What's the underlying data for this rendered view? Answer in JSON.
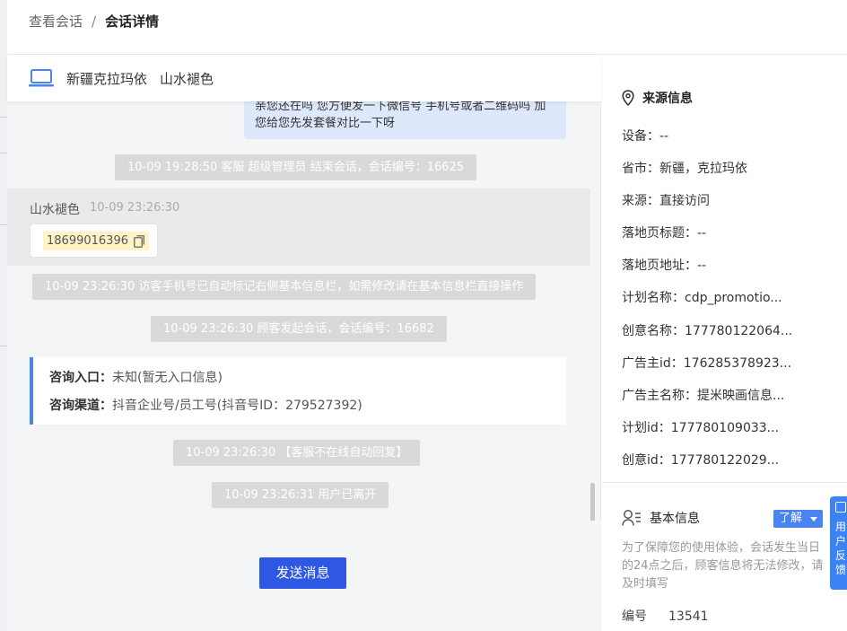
{
  "breadcrumb": {
    "parent": "查看会话",
    "separator": "/",
    "current": "会话详情"
  },
  "chat_header": {
    "location": "新疆克拉玛依",
    "nickname": "山水褪色"
  },
  "messages": {
    "agent_bubble_text": "亲您还在吗 您方便发一下微信号 手机号或者二维码吗 加您给您先发套餐对比一下呀",
    "sys1": "10-09 19:28:50 客服 超级管理员 结束会话，会话编号：16625",
    "visitor_name": "山水褪色",
    "visitor_time": "10-09 23:26:30",
    "visitor_phone": "18699016396",
    "sys2": "10-09 23:26:30 访客手机号已自动标记右侧基本信息栏，如需修改请在基本信息栏直接操作",
    "sys3": "10-09 23:26:30 顾客发起会话，会话编号：16682",
    "entry_label": "咨询入口：",
    "entry_value": "未知(暂无入口信息)",
    "channel_label": "咨询渠道：",
    "channel_value": "抖音企业号/员工号(抖音号ID：279527392)",
    "sys4": "10-09 23:26:30 【客服不在线自动回复】",
    "sys5": "10-09 23:26:31 用户已离开"
  },
  "send_button": "发送消息",
  "source": {
    "title": "来源信息",
    "device": "设备：--",
    "province_city": "省市：新疆，克拉玛依",
    "origin": "来源：直接访问",
    "landing_title": "落地页标题：--",
    "landing_url": "落地页地址：--",
    "plan_name": "计划名称：cdp_promotio...",
    "creative_name": "创意名称：177780122064...",
    "advertiser_id": "广告主id：176285378923...",
    "advertiser_name": "广告主名称：提米映画信息...",
    "plan_id": "计划id：177780109033...",
    "creative_id": "创意id：177780122029..."
  },
  "basic_info": {
    "title": "基本信息",
    "learn_more": "了解",
    "note": "为了保障您的使用体验，会话发生当日的24点之后，顾客信息将无法修改，请及时填写",
    "id_label": "编号",
    "id_value": "13541"
  },
  "feedback": {
    "label": "用户反馈"
  },
  "colors": {
    "primary": "#2e57e3",
    "accent": "#4a84f0",
    "sys_bg": "#d9d9d9",
    "agent_bubble": "#dde8fb"
  }
}
